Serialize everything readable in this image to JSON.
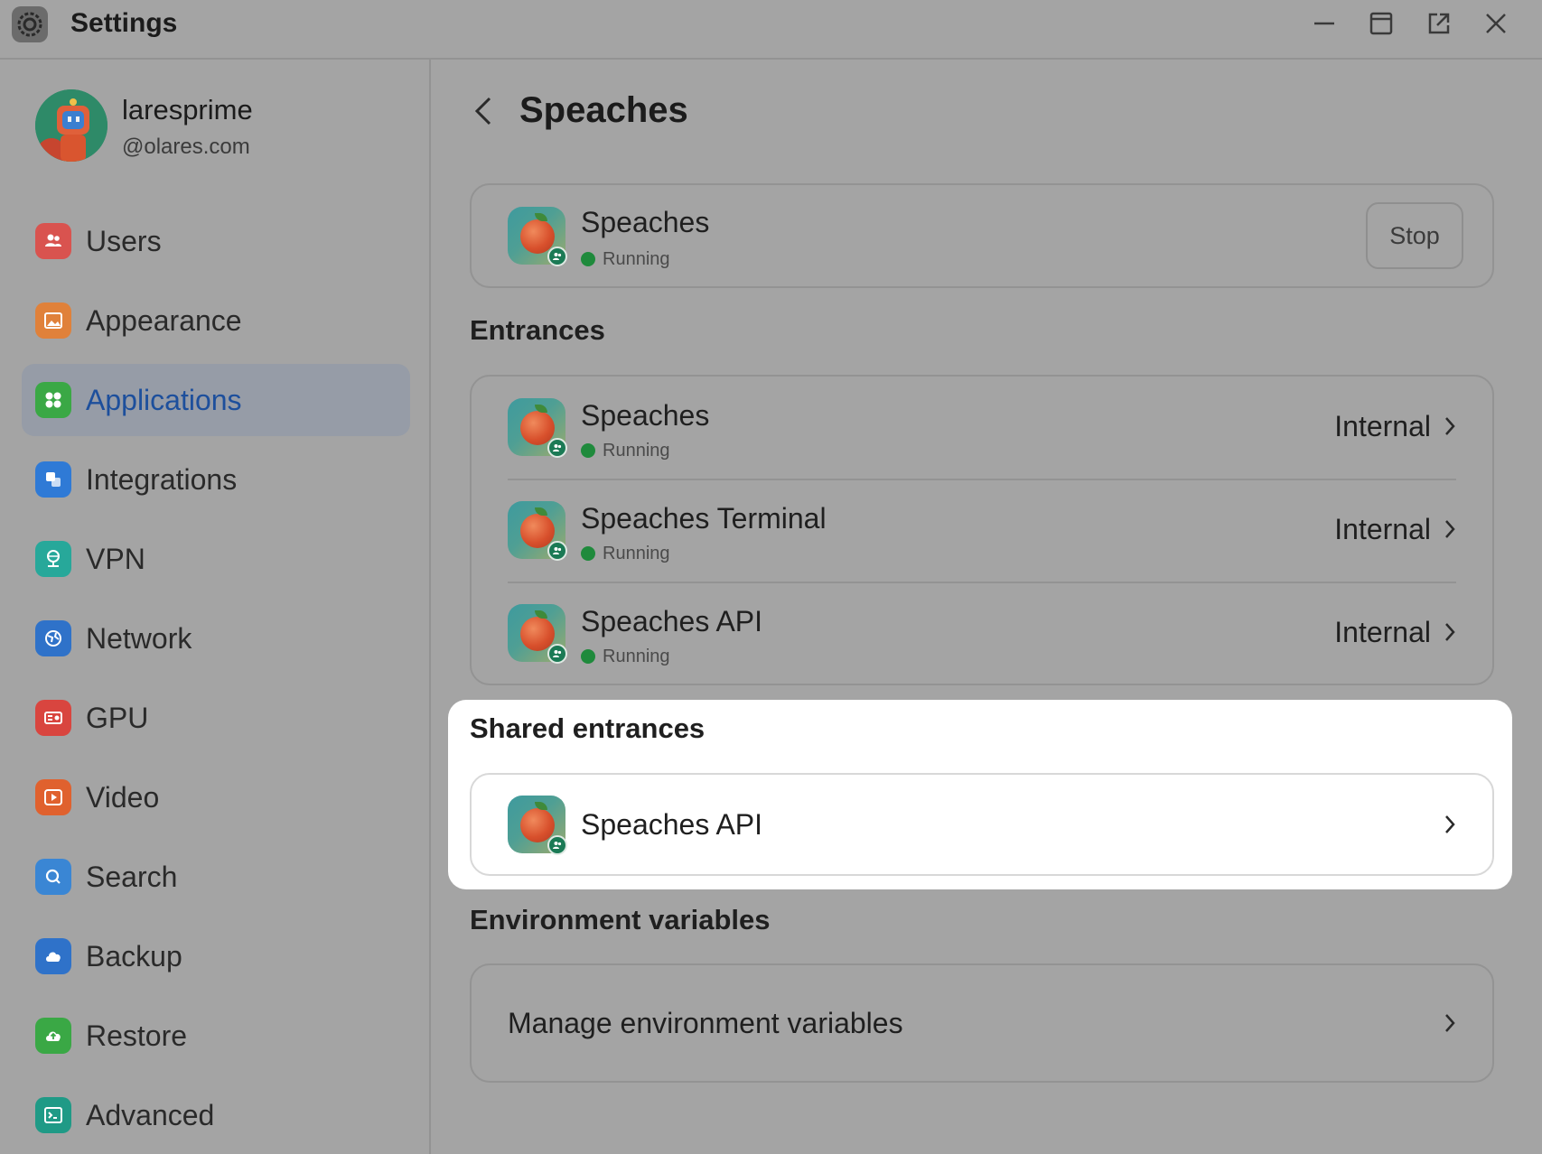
{
  "window": {
    "title": "Settings",
    "icon": "gear-icon",
    "controls": [
      "minimize-icon",
      "maximize-icon",
      "popout-icon",
      "close-icon"
    ]
  },
  "user": {
    "name": "laresprime",
    "domain": "@olares.com"
  },
  "sidebar": {
    "items": [
      {
        "label": "Users",
        "icon": "users-icon",
        "color": "#d9534f"
      },
      {
        "label": "Appearance",
        "icon": "image-icon",
        "color": "#e0813a"
      },
      {
        "label": "Applications",
        "icon": "apps-icon",
        "color": "#3aa845",
        "active": true
      },
      {
        "label": "Integrations",
        "icon": "integrations-icon",
        "color": "#2f7ad6"
      },
      {
        "label": "VPN",
        "icon": "vpn-icon",
        "color": "#27a89a"
      },
      {
        "label": "Network",
        "icon": "network-icon",
        "color": "#2f72c9"
      },
      {
        "label": "GPU",
        "icon": "gpu-icon",
        "color": "#d9453f"
      },
      {
        "label": "Video",
        "icon": "video-icon",
        "color": "#e0612e"
      },
      {
        "label": "Search",
        "icon": "search-icon",
        "color": "#3a86d4"
      },
      {
        "label": "Backup",
        "icon": "cloud-icon",
        "color": "#2f72c9"
      },
      {
        "label": "Restore",
        "icon": "restore-icon",
        "color": "#3aa845"
      },
      {
        "label": "Advanced",
        "icon": "terminal-icon",
        "color": "#1f9a86"
      }
    ]
  },
  "page": {
    "title": "Speaches"
  },
  "app_card": {
    "name": "Speaches",
    "status": "Running",
    "stop_label": "Stop"
  },
  "entrances": {
    "title": "Entrances",
    "rows": [
      {
        "name": "Speaches",
        "status": "Running",
        "access": "Internal"
      },
      {
        "name": "Speaches Terminal",
        "status": "Running",
        "access": "Internal"
      },
      {
        "name": "Speaches API",
        "status": "Running",
        "access": "Internal"
      }
    ]
  },
  "shared_entrances": {
    "title": "Shared entrances",
    "rows": [
      {
        "name": "Speaches API"
      }
    ]
  },
  "environment": {
    "title": "Environment variables",
    "manage_label": "Manage environment variables"
  },
  "colors": {
    "status_running": "#1f8a3c",
    "active_nav_text": "#1d4f9c"
  }
}
